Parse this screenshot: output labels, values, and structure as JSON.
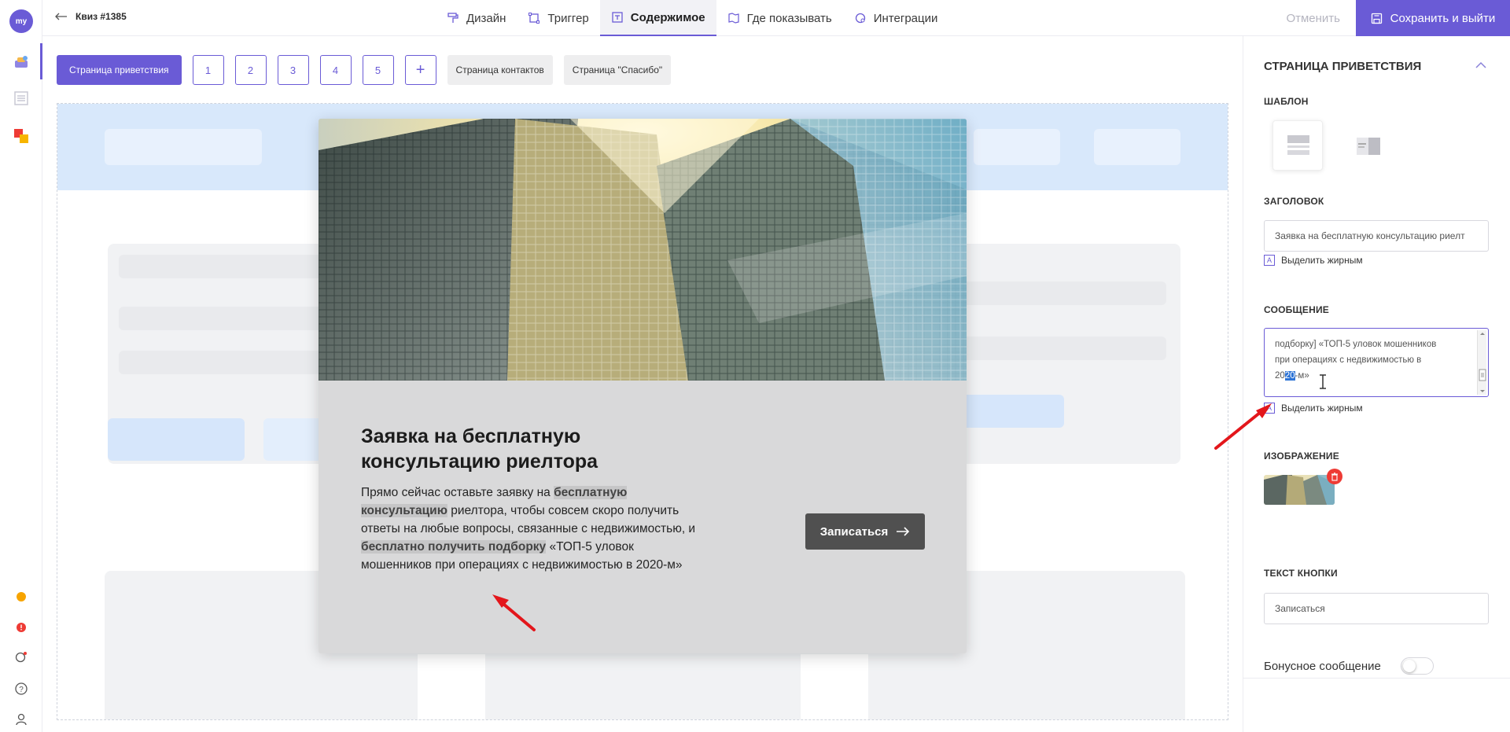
{
  "rail": {
    "logo_text": "my"
  },
  "topbar": {
    "back_label": "Квиз #1385",
    "tabs": [
      {
        "label": "Дизайн",
        "icon": "paint-roller-icon"
      },
      {
        "label": "Триггер",
        "icon": "selection-icon"
      },
      {
        "label": "Содержимое",
        "icon": "text-box-icon",
        "active": true
      },
      {
        "label": "Где показывать",
        "icon": "map-icon"
      },
      {
        "label": "Интеграции",
        "icon": "integration-icon"
      }
    ],
    "cancel_label": "Отменить",
    "save_label": "Сохранить и выйти"
  },
  "page_tabs": {
    "welcome": "Страница приветствия",
    "numbers": [
      "1",
      "2",
      "3",
      "4",
      "5"
    ],
    "add": "+",
    "contacts": "Страница контактов",
    "thanks": "Страница \"Спасибо\""
  },
  "modal": {
    "title": "Заявка на бесплатную консультацию риелтора",
    "msg_part1": "Прямо сейчас оставьте заявку на ",
    "msg_bold1": "бесплатную консультацию",
    "msg_part2": " риелтора, чтобы совсем скоро получить ответы на любые вопросы, связанные с недвижимостью, и ",
    "msg_bold2": "бесплатно получить подборку",
    "msg_part3": " «ТОП-5 уловок мошенников при операциях с недвижимостью в 2020-м»",
    "button_label": "Записаться"
  },
  "panel": {
    "title": "СТРАНИЦА ПРИВЕТСТВИЯ",
    "template_label": "ШАБЛОН",
    "heading_label": "ЗАГОЛОВОК",
    "heading_value": "Заявка на бесплатную консультацию риелт",
    "bold_label": "Выделить жирным",
    "message_label": "СООБЩЕНИЕ",
    "message_line1": "подборку] «ТОП-5 уловок мошенников",
    "message_line2": "при операциях с недвижимостью в",
    "message_line3_pre": "20",
    "message_line3_sel": "20",
    "message_line3_post": "-м»",
    "message_bold_label": "Выделить жирным",
    "image_label": "ИЗОБРАЖЕНИЕ",
    "button_text_label": "ТЕКСТ КНОПКИ",
    "button_text_value": "Записаться",
    "bonus_label": "Бонусное сообщение",
    "bonus_enabled": false
  },
  "colors": {
    "accent": "#6a5bd6",
    "danger": "#ee3b35",
    "annotation": "#e3161b"
  }
}
